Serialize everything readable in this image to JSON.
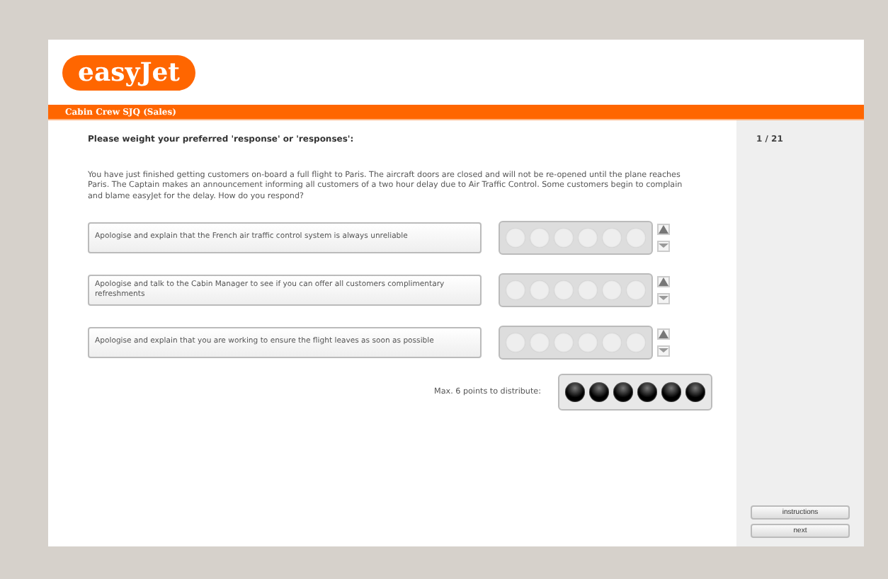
{
  "logo": "easyJet",
  "header": {
    "title": "Cabin Crew SJQ (Sales)"
  },
  "question": {
    "prompt": "Please weight your preferred 'response' or 'responses':",
    "scenario": "You have just finished getting customers on-board a full flight to Paris. The aircraft doors are closed and will not be re-opened until the plane reaches Paris. The Captain makes an announcement informing all customers of a two hour delay due to Air Traffic Control.  Some customers begin to complain and blame easyJet for the delay. How do you respond?"
  },
  "responses": [
    {
      "text": "Apologise and explain that the French air traffic control system is always unreliable",
      "points": [
        {
          "filled": false
        },
        {
          "filled": false
        },
        {
          "filled": false
        },
        {
          "filled": false
        },
        {
          "filled": false
        },
        {
          "filled": false
        }
      ]
    },
    {
      "text": "Apologise and talk to the Cabin Manager to see if you can offer all customers complimentary refreshments",
      "points": [
        {
          "filled": false
        },
        {
          "filled": false
        },
        {
          "filled": false
        },
        {
          "filled": false
        },
        {
          "filled": false
        },
        {
          "filled": false
        }
      ]
    },
    {
      "text": "Apologise and explain that you are working to ensure the flight leaves as soon as possible",
      "points": [
        {
          "filled": false
        },
        {
          "filled": false
        },
        {
          "filled": false
        },
        {
          "filled": false
        },
        {
          "filled": false
        },
        {
          "filled": false
        }
      ]
    }
  ],
  "pool": {
    "label": "Max. 6 points to distribute:",
    "points": [
      {
        "filled": true
      },
      {
        "filled": true
      },
      {
        "filled": true
      },
      {
        "filled": true
      },
      {
        "filled": true
      },
      {
        "filled": true
      }
    ]
  },
  "sidebar": {
    "progress": "1 / 21",
    "buttons": [
      "instructions",
      "next"
    ]
  }
}
